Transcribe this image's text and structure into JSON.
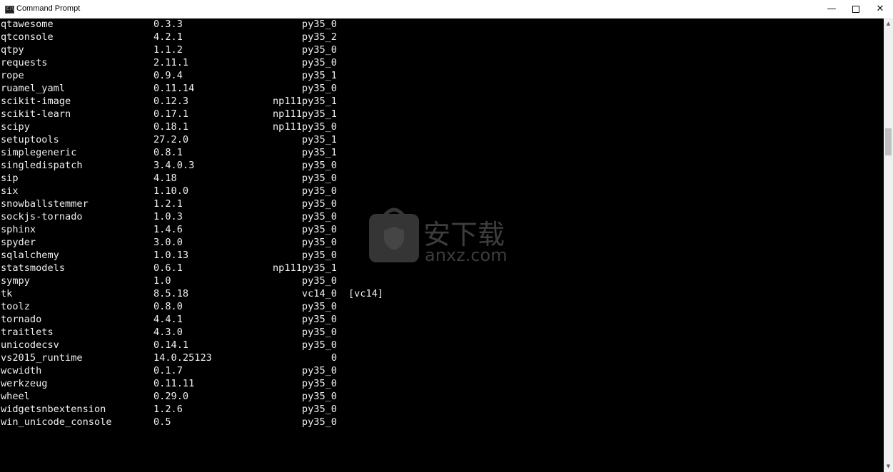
{
  "window": {
    "title": "Command Prompt",
    "icon": "cmd-icon",
    "controls": [
      "minimize",
      "maximize",
      "close"
    ]
  },
  "packages": [
    [
      "qtawesome",
      "0.3.3",
      "py35_0",
      ""
    ],
    [
      "qtconsole",
      "4.2.1",
      "py35_2",
      ""
    ],
    [
      "qtpy",
      "1.1.2",
      "py35_0",
      ""
    ],
    [
      "requests",
      "2.11.1",
      "py35_0",
      ""
    ],
    [
      "rope",
      "0.9.4",
      "py35_1",
      ""
    ],
    [
      "ruamel_yaml",
      "0.11.14",
      "py35_0",
      ""
    ],
    [
      "scikit-image",
      "0.12.3",
      "np111py35_1",
      ""
    ],
    [
      "scikit-learn",
      "0.17.1",
      "np111py35_1",
      ""
    ],
    [
      "scipy",
      "0.18.1",
      "np111py35_0",
      ""
    ],
    [
      "setuptools",
      "27.2.0",
      "py35_1",
      ""
    ],
    [
      "simplegeneric",
      "0.8.1",
      "py35_1",
      ""
    ],
    [
      "singledispatch",
      "3.4.0.3",
      "py35_0",
      ""
    ],
    [
      "sip",
      "4.18",
      "py35_0",
      ""
    ],
    [
      "six",
      "1.10.0",
      "py35_0",
      ""
    ],
    [
      "snowballstemmer",
      "1.2.1",
      "py35_0",
      ""
    ],
    [
      "sockjs-tornado",
      "1.0.3",
      "py35_0",
      ""
    ],
    [
      "sphinx",
      "1.4.6",
      "py35_0",
      ""
    ],
    [
      "spyder",
      "3.0.0",
      "py35_0",
      ""
    ],
    [
      "sqlalchemy",
      "1.0.13",
      "py35_0",
      ""
    ],
    [
      "statsmodels",
      "0.6.1",
      "np111py35_1",
      ""
    ],
    [
      "sympy",
      "1.0",
      "py35_0",
      ""
    ],
    [
      "tk",
      "8.5.18",
      "vc14_0",
      "[vc14]"
    ],
    [
      "toolz",
      "0.8.0",
      "py35_0",
      ""
    ],
    [
      "tornado",
      "4.4.1",
      "py35_0",
      ""
    ],
    [
      "traitlets",
      "4.3.0",
      "py35_0",
      ""
    ],
    [
      "unicodecsv",
      "0.14.1",
      "py35_0",
      ""
    ],
    [
      "vs2015_runtime",
      "14.0.25123",
      "0",
      ""
    ],
    [
      "wcwidth",
      "0.1.7",
      "py35_0",
      ""
    ],
    [
      "werkzeug",
      "0.11.11",
      "py35_0",
      ""
    ],
    [
      "wheel",
      "0.29.0",
      "py35_0",
      ""
    ],
    [
      "widgetsnbextension",
      "1.2.6",
      "py35_0",
      ""
    ],
    [
      "win_unicode_console",
      "0.5",
      "py35_0",
      ""
    ]
  ],
  "watermark": {
    "text": "安下载",
    "sub": "anxz.com"
  }
}
